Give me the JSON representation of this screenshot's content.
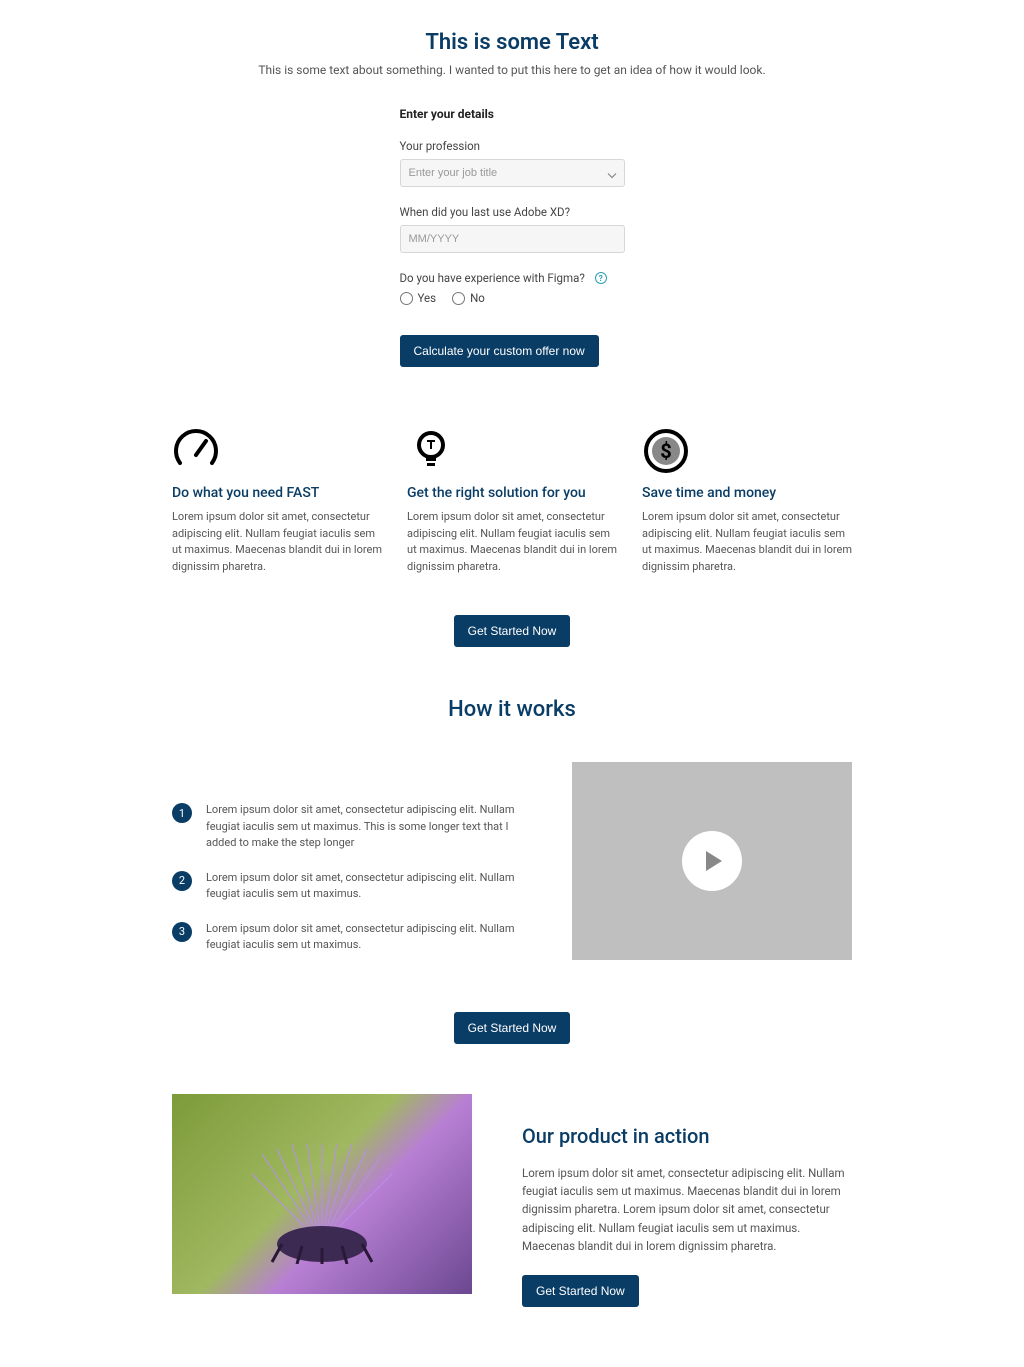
{
  "hero": {
    "title": "This is some Text",
    "subtitle": "This is some text about something. I wanted to put this here to get an idea of how it would look."
  },
  "form": {
    "heading": "Enter your details",
    "profession_label": "Your profession",
    "profession_placeholder": "Enter your job title",
    "xd_label": "When did you last use Adobe XD?",
    "xd_placeholder": "MM/YYYY",
    "figma_label": "Do you have experience with Figma?",
    "yes": "Yes",
    "no": "No",
    "submit": "Calculate your custom offer now"
  },
  "features": [
    {
      "title": "Do what you need FAST",
      "desc": "Lorem ipsum dolor sit amet, consectetur adipiscing elit. Nullam feugiat iaculis sem ut maximus. Maecenas blandit dui in lorem dignissim pharetra."
    },
    {
      "title": "Get the right solution for you",
      "desc": "Lorem ipsum dolor sit amet, consectetur adipiscing elit. Nullam feugiat iaculis sem ut maximus. Maecenas blandit dui in lorem dignissim pharetra."
    },
    {
      "title": "Save time and money",
      "desc": "Lorem ipsum dolor sit amet, consectetur adipiscing elit. Nullam feugiat iaculis sem ut maximus. Maecenas blandit dui in lorem dignissim pharetra."
    }
  ],
  "get_started": "Get Started Now",
  "hiw": {
    "title": "How it works",
    "steps": [
      "Lorem ipsum dolor sit amet, consectetur adipiscing elit. Nullam feugiat iaculis sem ut maximus. This is some longer text that I added to make the step longer",
      "Lorem ipsum dolor sit amet, consectetur adipiscing elit. Nullam feugiat iaculis sem ut maximus.",
      "Lorem ipsum dolor sit amet, consectetur adipiscing elit. Nullam feugiat iaculis sem ut maximus."
    ]
  },
  "product": {
    "title": "Our product in action",
    "desc": "Lorem ipsum dolor sit amet, consectetur adipiscing elit. Nullam feugiat iaculis sem ut maximus. Maecenas blandit dui in lorem dignissim pharetra. Lorem ipsum dolor sit amet, consectetur adipiscing elit. Nullam feugiat iaculis sem ut maximus. Maecenas blandit dui in lorem dignissim pharetra."
  },
  "numbers": {
    "1": "1",
    "2": "2",
    "3": "3"
  },
  "info_glyph": "?"
}
